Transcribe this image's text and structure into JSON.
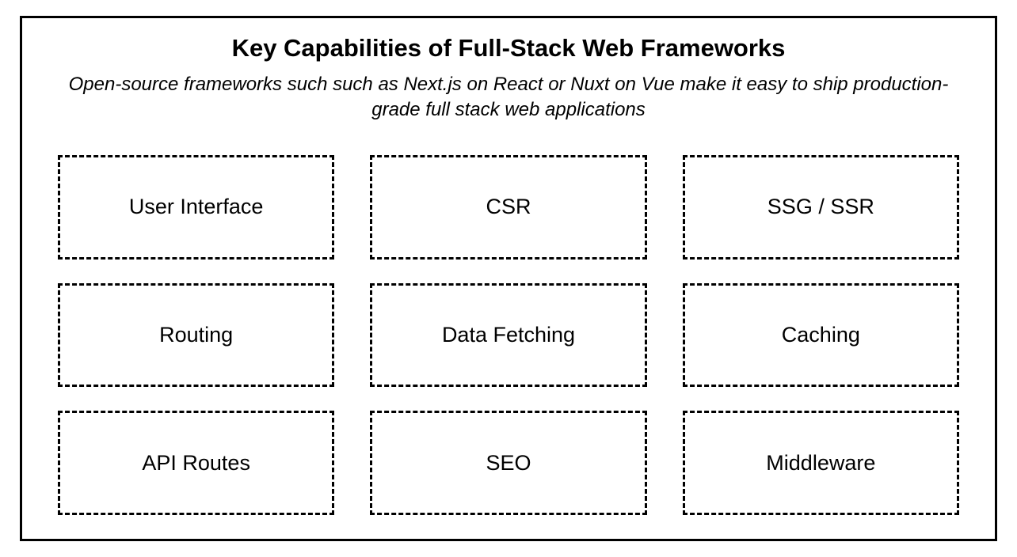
{
  "title": "Key Capabilities of Full-Stack Web Frameworks",
  "subtitle": "Open-source frameworks such such as Next.js on React or Nuxt on Vue make it easy to ship production-grade full stack web applications",
  "capabilities": [
    "User Interface",
    "CSR",
    "SSG / SSR",
    "Routing",
    "Data Fetching",
    "Caching",
    "API Routes",
    "SEO",
    "Middleware"
  ]
}
